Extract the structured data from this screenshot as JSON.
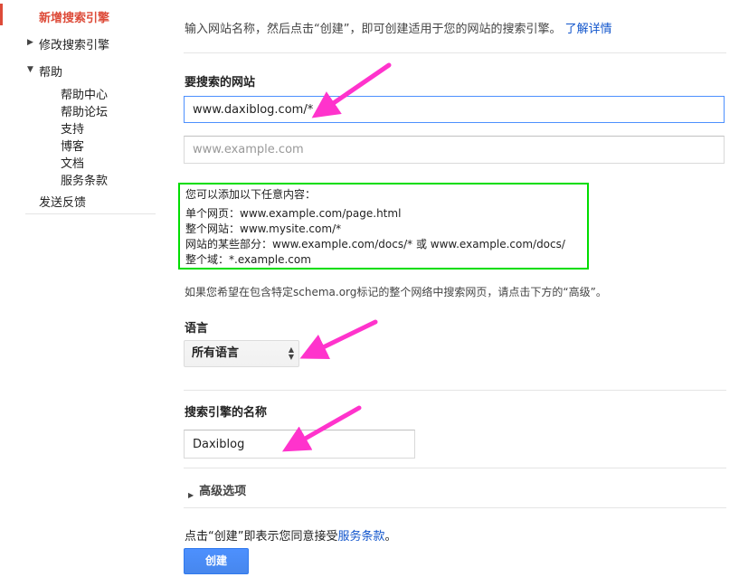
{
  "sidebar": {
    "items": [
      {
        "label": "新增搜索引擎"
      },
      {
        "label": "修改搜索引擎"
      },
      {
        "label": "帮助"
      },
      {
        "label": "发送反馈"
      }
    ],
    "help_items": [
      "帮助中心",
      "帮助论坛",
      "支持",
      "博客",
      "文档",
      "服务条款"
    ]
  },
  "main": {
    "intro_text": "输入网站名称，然后点击“创建”，即可创建适用于您的网站的搜索引擎。",
    "learn_more_link": "了解详情",
    "sites_label": "要搜索的网站",
    "site_input_1_value": "www.daxiblog.com/*",
    "site_input_2_placeholder": "www.example.com",
    "hint": {
      "title": "您可以添加以下任意内容：",
      "lines": [
        "单个网页：www.example.com/page.html",
        "整个网站：www.mysite.com/*",
        "网站的某些部分：www.example.com/docs/* 或 www.example.com/docs/",
        "整个域：*.example.com"
      ]
    },
    "schema_note": "如果您希望在包含特定schema.org标记的整个网络中搜索网页，请点击下方的“高级”。",
    "language_label": "语言",
    "language_selected": "所有语言",
    "name_label": "搜索引擎的名称",
    "name_input_value": "Daxiblog",
    "advanced_label": "高级选项",
    "terms_prefix": "点击“创建”即表示您同意接受",
    "terms_link": "服务条款",
    "terms_suffix": "。",
    "create_button": "创建"
  },
  "colors": {
    "accent_red": "#dd4b39",
    "link_blue": "#1155cc",
    "primary_button": "#4d90fe",
    "hint_border": "#00dd00",
    "annotation_arrow": "#ff33cc"
  }
}
